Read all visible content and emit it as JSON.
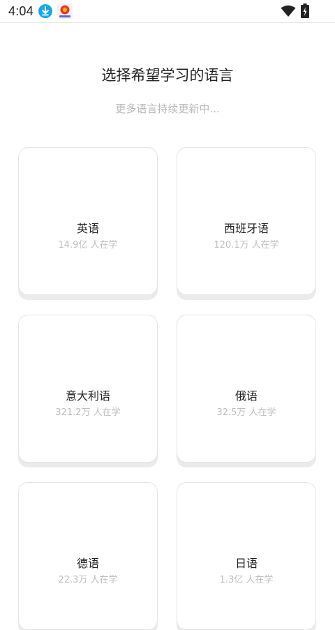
{
  "status": {
    "time": "4:04",
    "icons": [
      "download-icon",
      "app-notification-icon",
      "wifi-icon",
      "battery-icon"
    ]
  },
  "header": {
    "title": "选择希望学习的语言",
    "subtitle": "更多语言持续更新中..."
  },
  "languages": [
    {
      "name": "英语",
      "count": "14.9亿 人在学"
    },
    {
      "name": "西班牙语",
      "count": "120.1万 人在学"
    },
    {
      "name": "意大利语",
      "count": "321.2万 人在学"
    },
    {
      "name": "俄语",
      "count": "32.5万 人在学"
    },
    {
      "name": "德语",
      "count": "22.3万 人在学"
    },
    {
      "name": "日语",
      "count": "1.3亿 人在学"
    }
  ],
  "colors": {
    "accent_download": "#1aa7e8",
    "app_icon": "#e53935"
  }
}
